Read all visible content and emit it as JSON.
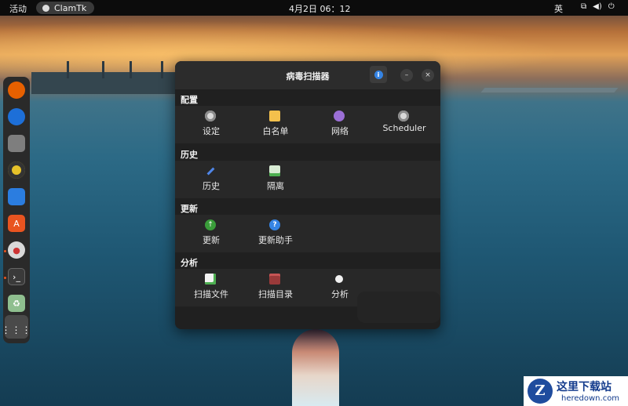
{
  "topbar": {
    "activities": "活动",
    "app_name": "ClamTk",
    "clock": "4月2日  06：12",
    "ime": "英"
  },
  "dock": {
    "items": [
      "firefox-icon",
      "thunderbird-icon",
      "files-icon",
      "rhythmbox-icon",
      "writer-icon",
      "software-icon",
      "clamtk-icon",
      "terminal-icon",
      "trash-icon",
      "app-grid-icon"
    ]
  },
  "window": {
    "title": "病毒扫描器",
    "info_icon": "i",
    "minimize": "–",
    "close": "×",
    "sections": {
      "config": {
        "title": "配置",
        "items": [
          "设定",
          "白名单",
          "网络",
          "Scheduler"
        ]
      },
      "history": {
        "title": "历史",
        "items": [
          "历史",
          "隔离"
        ]
      },
      "update": {
        "title": "更新",
        "items": [
          "更新",
          "更新助手"
        ]
      },
      "analysis": {
        "title": "分析",
        "items": [
          "扫描文件",
          "扫描目录",
          "分析"
        ]
      }
    }
  },
  "watermark": {
    "logo": "Z",
    "cn": "这里下载站",
    "en": "heredown.com"
  }
}
